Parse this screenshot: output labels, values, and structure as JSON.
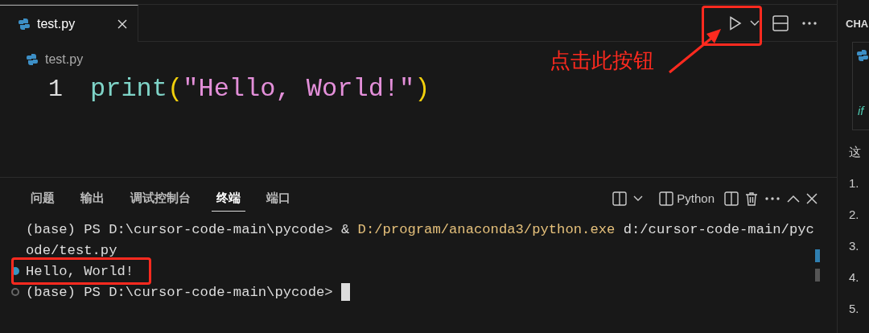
{
  "editor_tabs": [
    {
      "label": "test.py",
      "selected": true
    }
  ],
  "breadcrumb": "test.py",
  "code_lines": [
    {
      "number": "1",
      "tokens": [
        {
          "text": "print",
          "kind": "function"
        },
        {
          "text": "(",
          "kind": "bracket"
        },
        {
          "text": "\"Hello, World!\"",
          "kind": "string"
        },
        {
          "text": ")",
          "kind": "bracket"
        }
      ]
    }
  ],
  "annotation": {
    "text": "点击此按钮"
  },
  "panel_tabs": [
    {
      "label": "问题",
      "selected": false
    },
    {
      "label": "输出",
      "selected": false
    },
    {
      "label": "调试控制台",
      "selected": false
    },
    {
      "label": "终端",
      "selected": true
    },
    {
      "label": "端口",
      "selected": false
    }
  ],
  "terminal_profile": "Python",
  "terminal_rows": [
    {
      "marked": false,
      "cursor": false,
      "segments": [
        {
          "text": "(base) PS D:\\cursor-code-main\\pycode> & ",
          "kind": "plain"
        },
        {
          "text": "D:/program/anaconda3/python.exe",
          "kind": "command"
        },
        {
          "text": " d:/cursor-code-main/pyc",
          "kind": "plain"
        }
      ]
    },
    {
      "marked": false,
      "cursor": false,
      "segments": [
        {
          "text": "ode/test.py",
          "kind": "plain"
        }
      ]
    },
    {
      "marked": true,
      "succeeded": true,
      "cursor": false,
      "segments": [
        {
          "text": "Hello, World!",
          "kind": "plain"
        }
      ]
    },
    {
      "marked": true,
      "succeeded": false,
      "cursor": true,
      "segments": [
        {
          "text": "(base) PS D:\\cursor-code-main\\pycode> ",
          "kind": "plain"
        }
      ]
    }
  ],
  "side_panel": {
    "title": "CHA",
    "code_fragment": "if",
    "lines": [
      "这",
      "1.",
      "2.",
      "3.",
      "4.",
      "5."
    ]
  }
}
